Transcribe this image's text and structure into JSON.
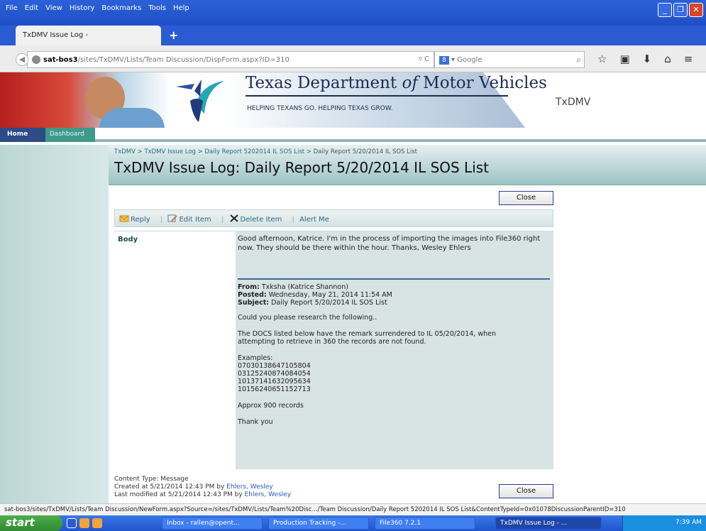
{
  "menubar": {
    "items": [
      "File",
      "Edit",
      "View",
      "History",
      "Bookmarks",
      "Tools",
      "Help"
    ]
  },
  "tab": {
    "title": "TxDMV Issue Log -"
  },
  "url": {
    "host": "sat-bos3",
    "path": "/sites/TxDMV/Lists/Team Discussion/DispForm.aspx?ID=310"
  },
  "search": {
    "placeholder": "Google",
    "engine": "8"
  },
  "banner": {
    "title_pre": "Texas Department ",
    "title_of": "of",
    "title_post": " Motor Vehicles",
    "tagline": "HELPING TEXANS GO. HELPING TEXAS GROW.",
    "site": "TxDMV"
  },
  "nav": {
    "home": "Home",
    "dashboard": "Dashboard"
  },
  "breadcrumb": {
    "root": "TxDMV",
    "sep": " > ",
    "list": "TxDMV Issue Log",
    "parent": "Daily Report 5202014 IL SOS List",
    "current": "Daily Report 5/20/2014 IL SOS List"
  },
  "page_title": "TxDMV Issue Log: Daily Report 5/20/2014 IL SOS List",
  "buttons": {
    "close": "Close"
  },
  "toolbar": {
    "reply": "Reply",
    "edit": "Edit Item",
    "delete": "Delete Item",
    "alert": "Alert Me"
  },
  "form": {
    "body_label": "Body",
    "reply_text": "Good afternoon, Katrice. I'm in the process of importing the images into File360 right now. They should be there within the hour. Thanks, Wesley Ehlers",
    "from_label": "From:",
    "from_value": " Txksha (Katrice Shannon)",
    "posted_label": "Posted:",
    "posted_value": " Wednesday, May 21, 2014 11:54 AM",
    "subject_label": "Subject:",
    "subject_value": " Daily Report 5/20/2014 IL SOS List",
    "line_research": "Could you please research the following..",
    "line_docs_1": "The DOCS listed below have the remark surrendered to IL 05/20/2014, when",
    "line_docs_2": "attempting to retrieve in 360 the records are not found.",
    "examples_label": "Examples:",
    "examples": [
      "07030138647105804",
      "03125240874084054",
      "10137141632095634",
      "10156240651152713"
    ],
    "approx": "Approx 900 records",
    "thanks": "Thank you"
  },
  "meta": {
    "content_type": "Content Type: Message",
    "created_prefix": "Created at 5/21/2014 12:43 PM  by ",
    "created_by": "Ehlers, Wesley",
    "modified_prefix": "Last modified at 5/21/2014 12:43 PM  by ",
    "modified_by": "Ehlers, Wesley"
  },
  "status_url": "sat-bos3/sites/TxDMV/Lists/Team Discussion/NewForm.aspx?Source=/sites/TxDMV/Lists/Team%20Disc.../Team Discussion/Daily Report 5202014 IL SOS List&ContentTypeId=0x01078DiscussionParentID=310",
  "taskbar": {
    "start": "start",
    "items": [
      "Inbox - rallen@opent...",
      "Production Tracking -...",
      "File360 7.2.1",
      "TxDMV Issue Log - ..."
    ],
    "clock": "7:39 AM"
  }
}
